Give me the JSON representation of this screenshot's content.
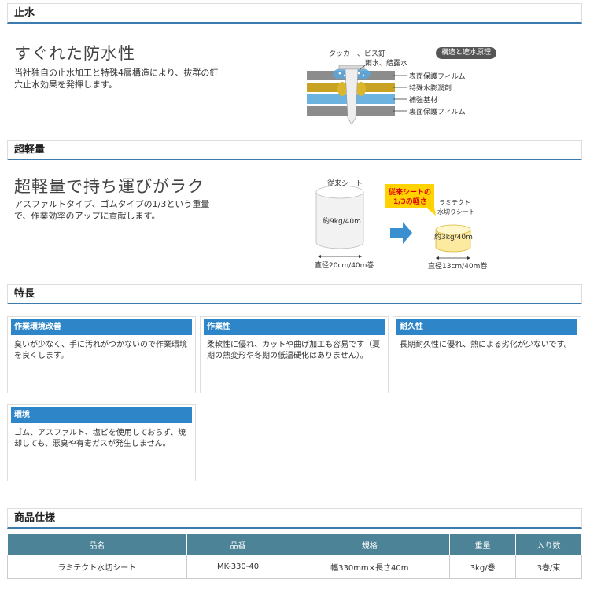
{
  "sections": {
    "waterproof": {
      "title": "止水",
      "headline": "すぐれた防水性",
      "text": "当社独自の止水加工と特殊4層構造により、抜群の釘穴止水効果を発揮します。",
      "figure": {
        "pill": "構造と遮水原理",
        "nail_label": "タッカー、ビス釘",
        "water_label": "雨水、結露水",
        "layers": [
          "表面保護フィルム",
          "特殊水膨潤剤",
          "補強基材",
          "裏面保護フィルム"
        ],
        "layer_colors": [
          "#8c8c8c",
          "#c8a222",
          "#6db3e0",
          "#8c8c8c"
        ]
      }
    },
    "lightweight": {
      "title": "超軽量",
      "headline": "超軽量で持ち運びがラク",
      "text": "アスファルトタイプ、ゴムタイプの1/3という重量で、作業効率のアップに貢献します。",
      "figure": {
        "old_label": "従来シート",
        "old_weight": "約9kg/40m",
        "old_diameter": "直径20cm/40m巻",
        "callout_line1": "従来シートの",
        "callout_line2": "1/3の軽さ",
        "new_label_line1": "ラミテクト",
        "new_label_line2": "水切りシート",
        "new_weight": "約3kg/40m",
        "new_diameter": "直径13cm/40m巻"
      }
    },
    "features": {
      "title": "特長",
      "cards": [
        {
          "title": "作業環境改善",
          "body": "臭いが少なく、手に汚れがつかないので作業環境を良くします。"
        },
        {
          "title": "作業性",
          "body": "柔軟性に優れ、カットや曲げ加工も容易です（夏期の熱変形や冬期の低温硬化はありません）。"
        },
        {
          "title": "耐久性",
          "body": "長期耐久性に優れ、熱による劣化が少ないです。"
        },
        {
          "title": "環境",
          "body": "ゴム、アスファルト、塩ビを使用しておらず、焼却しても、悪臭や有毒ガスが発生しません。"
        }
      ]
    },
    "spec": {
      "title": "商品仕様",
      "headers": [
        "品名",
        "品番",
        "規格",
        "重量",
        "入り数"
      ],
      "rows": [
        [
          "ラミテクト水切シート",
          "MK-330-40",
          "幅330mm×長さ40m",
          "3kg/巻",
          "3巻/束"
        ]
      ]
    }
  },
  "colors": {
    "accent_blue": "#2e86c8",
    "table_header": "#4d8396",
    "callout_yellow": "#ffd200",
    "callout_red": "#e00000",
    "arrow_blue": "#3a8fd0"
  }
}
